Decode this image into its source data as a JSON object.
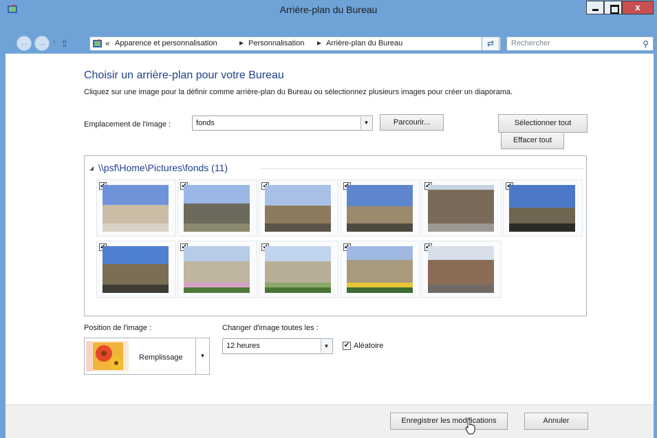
{
  "window": {
    "title": "Arrière-plan du Bureau",
    "close_label": "x"
  },
  "address": {
    "chevron": "«",
    "crumbs": [
      "Apparence et personnalisation",
      "Personnalisation",
      "Arrière-plan du Bureau"
    ],
    "search_placeholder": "Rechercher"
  },
  "main": {
    "heading": "Choisir un arrière-plan pour votre Bureau",
    "description": "Cliquez sur une image pour la définir comme arrière-plan du Bureau ou sélectionnez plusieurs images pour créer un diaporama.",
    "location_label": "Emplacement de l'image :",
    "location_value": "fonds",
    "browse_label": "Parcourir...",
    "select_all_label": "Sélectionner tout",
    "clear_all_label": "Effacer tout"
  },
  "gallery": {
    "group_title": "\\\\psf\\Home\\Pictures\\fonds (11)",
    "items": [
      {
        "checked": true,
        "subject": "hotel-de-ville"
      },
      {
        "checked": true,
        "subject": "cathedral-square"
      },
      {
        "checked": true,
        "subject": "parlement"
      },
      {
        "checked": true,
        "subject": "parlement-front"
      },
      {
        "checked": true,
        "subject": "street"
      },
      {
        "checked": true,
        "subject": "parlement-dark"
      },
      {
        "checked": true,
        "subject": "square-building"
      },
      {
        "checked": true,
        "subject": "thabor-garden"
      },
      {
        "checked": true,
        "subject": "thabor-garden-2"
      },
      {
        "checked": true,
        "subject": "palace-flowers"
      },
      {
        "checked": true,
        "subject": "timber-houses"
      }
    ]
  },
  "options": {
    "position_label": "Position de l'image :",
    "position_value": "Remplissage",
    "interval_label": "Changer d'image toutes les :",
    "interval_value": "12 heures",
    "shuffle_label": "Aléatoire",
    "shuffle_checked": true
  },
  "footer": {
    "save_label": "Enregistrer les modifications",
    "cancel_label": "Annuler"
  }
}
